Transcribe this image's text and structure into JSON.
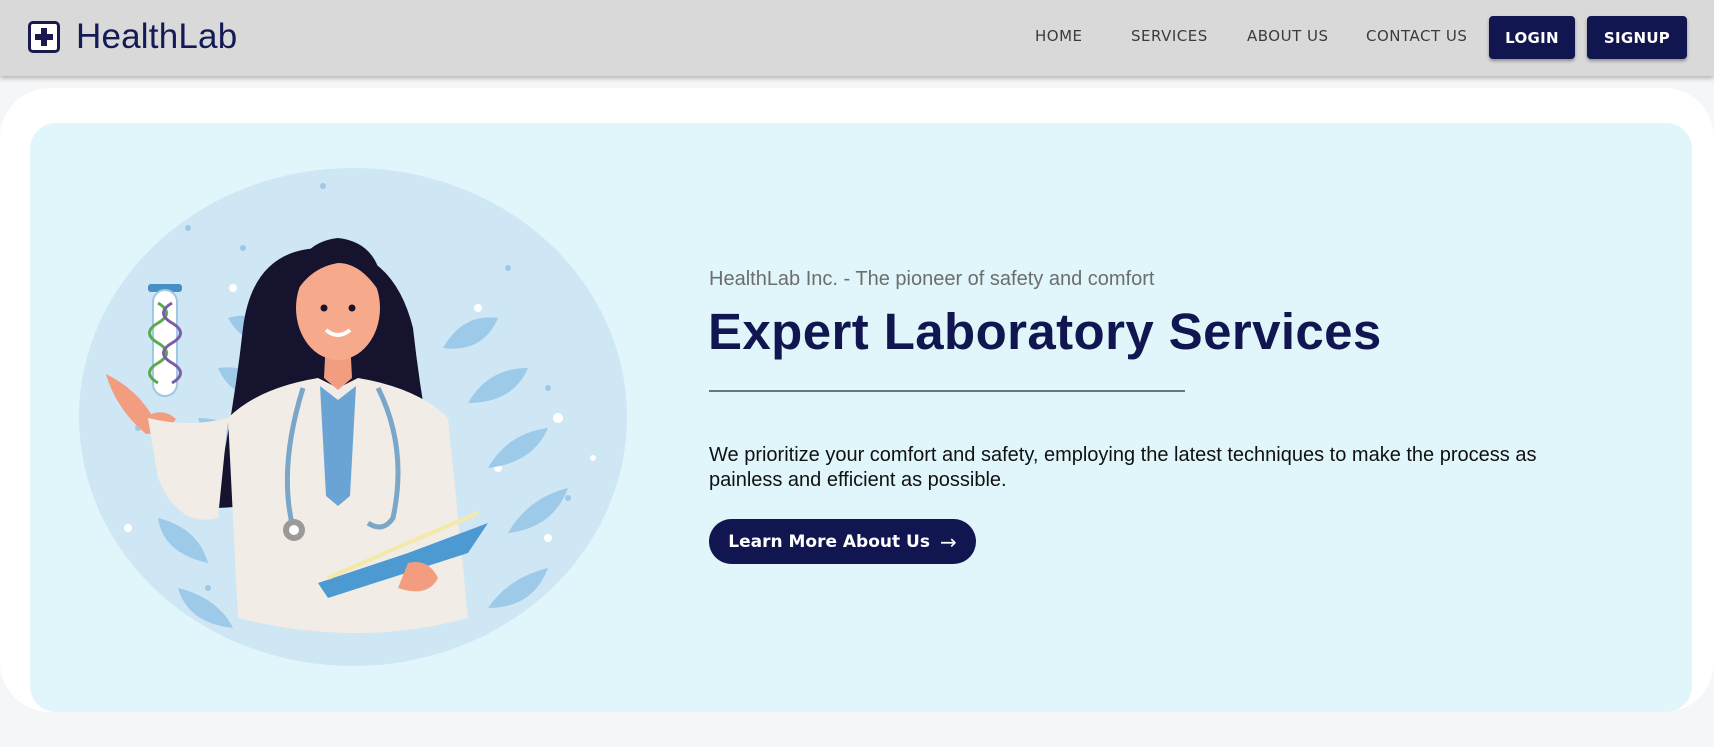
{
  "brand": {
    "name": "HealthLab",
    "icon": "medical-cross-icon"
  },
  "nav": {
    "links": [
      {
        "label": "HOME"
      },
      {
        "label": "SERVICES"
      },
      {
        "label": "ABOUT US"
      },
      {
        "label": "CONTACT US"
      }
    ],
    "login_label": "LOGIN",
    "signup_label": "SIGNUP"
  },
  "hero": {
    "tagline": "HealthLab Inc. - The pioneer of safety and comfort",
    "title": "Expert Laboratory Services",
    "description": "We prioritize your comfort and safety, employing the latest techniques to make the process as painless and efficient as possible.",
    "cta_label": "Learn More About Us",
    "cta_arrow": "→",
    "illustration": "doctor-with-test-tube-illustration"
  },
  "colors": {
    "navbar_bg": "#d9d9d9",
    "brand_navy": "#121650",
    "hero_bg": "#e0f6fb"
  }
}
